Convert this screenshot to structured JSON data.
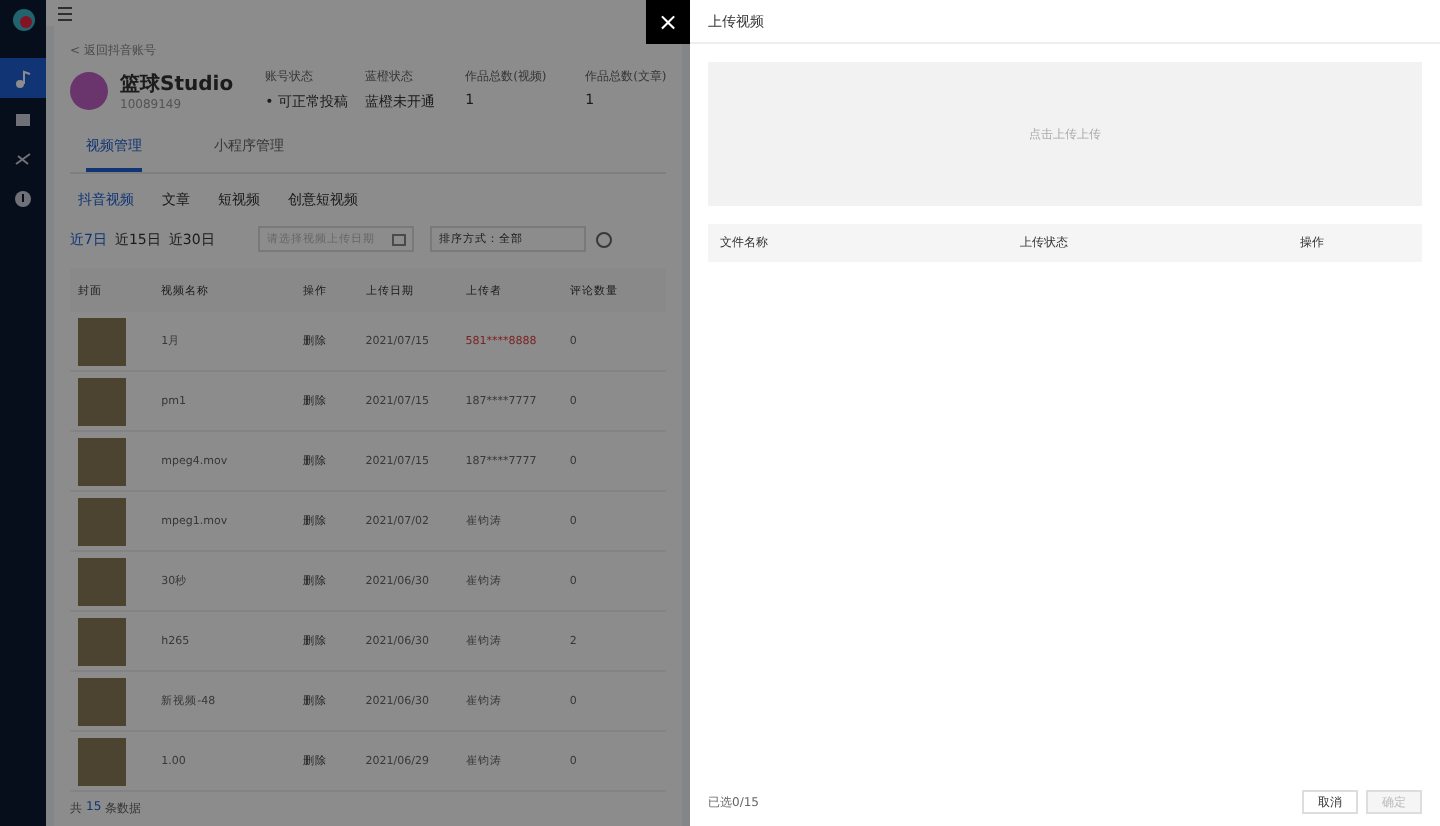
{
  "sidebar": {
    "items": [
      {
        "selected": true
      },
      {
        "selected": false
      },
      {
        "selected": false
      },
      {
        "selected": false
      }
    ]
  },
  "breadcrumb": "< 返回抖音账号",
  "account": {
    "name": "篮球Studio",
    "id": "10089149",
    "fields": [
      {
        "label": "账号状态",
        "value": "• 可正常投稿"
      },
      {
        "label": "蓝橙状态",
        "value": "蓝橙未开通"
      },
      {
        "label": "作品总数(视频)",
        "value": "1"
      },
      {
        "label": "作品总数(文章)",
        "value": "1"
      }
    ]
  },
  "tabs": [
    {
      "label": "视频管理",
      "selected": true
    },
    {
      "label": "小程序管理",
      "selected": false
    }
  ],
  "subtabs": [
    {
      "label": "抖音视频",
      "selected": true
    },
    {
      "label": "文章",
      "selected": false
    },
    {
      "label": "短视频",
      "selected": false
    },
    {
      "label": "创意短视频",
      "selected": false
    }
  ],
  "ranges": [
    {
      "label": "近7日",
      "selected": true
    },
    {
      "label": "近15日",
      "selected": false
    },
    {
      "label": "近30日",
      "selected": false
    }
  ],
  "date_field": {
    "placeholder": "请选择视频上传日期"
  },
  "sort_select": {
    "value": "排序方式：全部"
  },
  "table": {
    "columns": [
      "封面",
      "视频名称",
      "操作",
      "上传日期",
      "上传者",
      "评论数量"
    ],
    "rows": [
      {
        "name": "1月",
        "action": "删除",
        "date": "2021/07/15",
        "uploader": "581****8888",
        "uploader_highlight": true,
        "count": "0"
      },
      {
        "name": "pm1",
        "action": "删除",
        "date": "2021/07/15",
        "uploader": "187****7777",
        "uploader_highlight": false,
        "count": "0"
      },
      {
        "name": "mpeg4.mov",
        "action": "删除",
        "date": "2021/07/15",
        "uploader": "187****7777",
        "uploader_highlight": false,
        "count": "0"
      },
      {
        "name": "mpeg1.mov",
        "action": "删除",
        "date": "2021/07/02",
        "uploader": "崔钧涛",
        "uploader_highlight": false,
        "count": "0"
      },
      {
        "name": "30秒",
        "action": "删除",
        "date": "2021/06/30",
        "uploader": "崔钧涛",
        "uploader_highlight": false,
        "count": "0"
      },
      {
        "name": "h265",
        "action": "删除",
        "date": "2021/06/30",
        "uploader": "崔钧涛",
        "uploader_highlight": false,
        "count": "2"
      },
      {
        "name": "新视频-48",
        "action": "删除",
        "date": "2021/06/30",
        "uploader": "崔钧涛",
        "uploader_highlight": false,
        "count": "0"
      },
      {
        "name": "1.00",
        "action": "删除",
        "date": "2021/06/29",
        "uploader": "崔钧涛",
        "uploader_highlight": false,
        "count": "0"
      }
    ]
  },
  "total": {
    "prefix": "共",
    "count": "15",
    "suffix": "条数据"
  },
  "drawer": {
    "close": "×",
    "title": "上传视频",
    "dropzone": "点击上传上传",
    "columns": [
      "文件名称",
      "上传状态",
      "操作"
    ],
    "selected_count": "已选0/15",
    "buttons": [
      {
        "label": "取消",
        "kind": "default"
      },
      {
        "label": "确定",
        "kind": "disabled"
      }
    ]
  }
}
